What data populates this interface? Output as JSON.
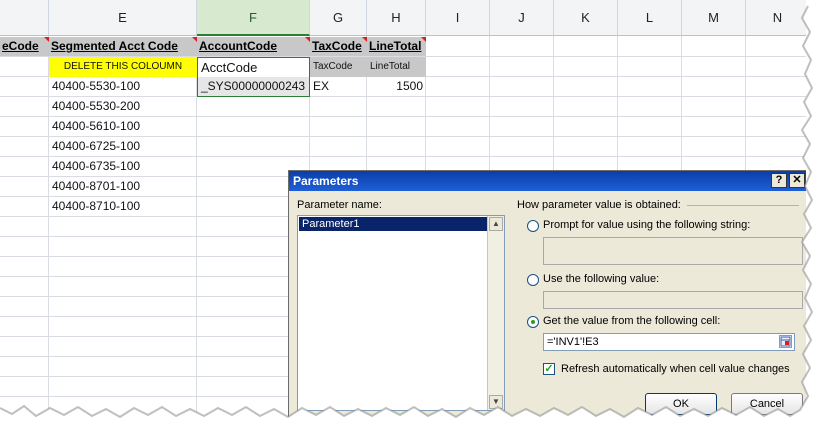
{
  "columns": [
    {
      "letter": "E",
      "selected": false
    },
    {
      "letter": "F",
      "selected": true
    },
    {
      "letter": "G",
      "selected": false
    },
    {
      "letter": "H",
      "selected": false
    },
    {
      "letter": "I",
      "selected": false
    },
    {
      "letter": "J",
      "selected": false
    },
    {
      "letter": "K",
      "selected": false
    },
    {
      "letter": "L",
      "selected": false
    },
    {
      "letter": "M",
      "selected": false
    },
    {
      "letter": "N",
      "selected": false
    }
  ],
  "header_row": {
    "d": "eCode",
    "e": "Segmented Acct Code",
    "f": "AccountCode",
    "g": "TaxCode",
    "h": "LineTotal"
  },
  "row2": {
    "e": "DELETE THIS COLOUMN",
    "f": "AcctCode",
    "g": "TaxCode",
    "h": "LineTotal"
  },
  "row3": {
    "e": "40400-5530-100",
    "f": "_SYS00000000243",
    "g": "EX",
    "h": "1500"
  },
  "acct_codes": [
    "40400-5530-200",
    "40400-5610-100",
    "40400-6725-100",
    "40400-6735-100",
    "40400-8701-100",
    "40400-8710-100"
  ],
  "dialog": {
    "title": "Parameters",
    "help_label": "?",
    "close_label": "✕",
    "param_name_label": "Parameter name:",
    "params": [
      "Parameter1"
    ],
    "how_label": "How parameter value is obtained:",
    "opt_prompt": "Prompt for value using the following string:",
    "opt_value": "Use the following value:",
    "opt_cell": "Get the value from the following cell:",
    "cell_ref": "='INV1'!E3",
    "refresh_label": "Refresh automatically when cell value changes",
    "ok_label": "OK",
    "cancel_label": "Cancel"
  },
  "colors": {
    "header_gray": "#c8c8c8",
    "delete_yellow": "#ffff00",
    "title_blue": "#0a3ea8",
    "selection_green": "#2e7d32"
  }
}
